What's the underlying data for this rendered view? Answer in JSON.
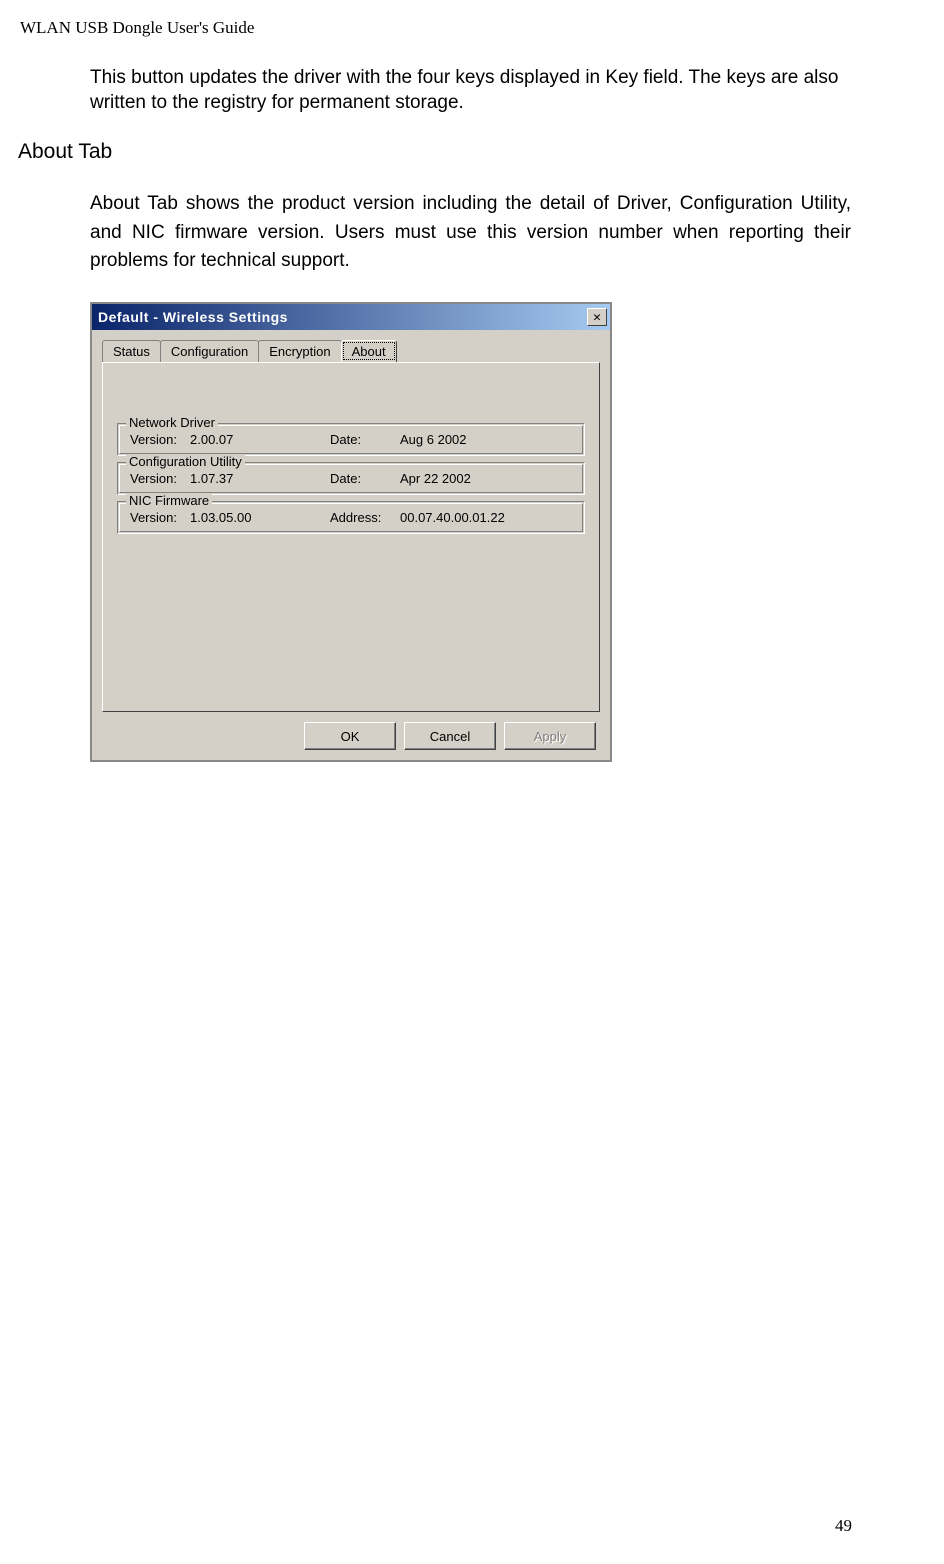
{
  "header": "WLAN USB Dongle User's Guide",
  "body_text_1": "This button updates the driver with the four keys displayed in Key field. The keys are also written to the registry for permanent storage.",
  "heading": "About Tab",
  "body_text_2": "About Tab shows the product version including the detail of Driver, Configuration Utility, and NIC firmware version. Users must use this version number when reporting their problems for technical support.",
  "dialog": {
    "title": "Default - Wireless Settings",
    "tabs": {
      "status": "Status",
      "configuration": "Configuration",
      "encryption": "Encryption",
      "about": "About"
    },
    "groups": {
      "driver": {
        "legend": "Network Driver",
        "version_label": "Version:",
        "version_value": "2.00.07",
        "date_label": "Date:",
        "date_value": "Aug  6 2002"
      },
      "utility": {
        "legend": "Configuration Utility",
        "version_label": "Version:",
        "version_value": "1.07.37",
        "date_label": "Date:",
        "date_value": "Apr 22 2002"
      },
      "firmware": {
        "legend": "NIC Firmware",
        "version_label": "Version:",
        "version_value": "1.03.05.00",
        "address_label": "Address:",
        "address_value": "00.07.40.00.01.22"
      }
    },
    "buttons": {
      "ok": "OK",
      "cancel": "Cancel",
      "apply": "Apply"
    }
  },
  "page_number": "49"
}
